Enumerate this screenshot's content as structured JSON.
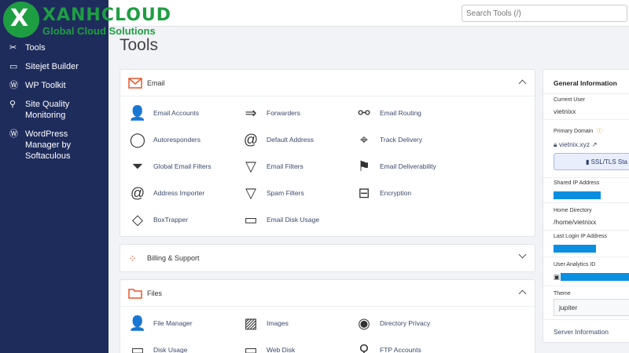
{
  "brand": {
    "logo_x": "X",
    "name": "XANHCLOUD",
    "tagline": "Global Cloud Solutions",
    "colors": {
      "sidebar": "#1e2c5c",
      "accent": "#1e9e42",
      "redaction": "#0a8fe0"
    }
  },
  "sidebar": {
    "items": [
      {
        "label": "Tools",
        "icon": "tools-icon"
      },
      {
        "label": "Sitejet Builder",
        "icon": "sitejet-icon"
      },
      {
        "label": "WP Toolkit",
        "icon": "wordpress-icon"
      },
      {
        "label": "Site Quality Monitoring",
        "icon": "magnifier-icon"
      },
      {
        "label": "WordPress Manager by Softaculous",
        "icon": "wordpress-icon"
      }
    ]
  },
  "search": {
    "placeholder": "Search Tools (/)"
  },
  "page": {
    "title": "Tools"
  },
  "email_panel": {
    "title": "Email",
    "tools": [
      {
        "label": "Email Accounts",
        "icon": "user-mail-icon"
      },
      {
        "label": "Forwarders",
        "icon": "forward-icon"
      },
      {
        "label": "Email Routing",
        "icon": "routing-icon"
      },
      {
        "label": "Autoresponders",
        "icon": "autoresponder-icon"
      },
      {
        "label": "Default Address",
        "icon": "at-sign-icon"
      },
      {
        "label": "Track Delivery",
        "icon": "location-pin-icon"
      },
      {
        "label": "Global Email Filters",
        "icon": "global-filter-icon"
      },
      {
        "label": "Email Filters",
        "icon": "filter-icon"
      },
      {
        "label": "Email Deliverability",
        "icon": "mailbox-icon"
      },
      {
        "label": "Address Importer",
        "icon": "at-import-icon"
      },
      {
        "label": "Spam Filters",
        "icon": "spam-filter-icon"
      },
      {
        "label": "Encryption",
        "icon": "encryption-icon"
      },
      {
        "label": "BoxTrapper",
        "icon": "boxtrapper-icon"
      },
      {
        "label": "Email Disk Usage",
        "icon": "disk-usage-icon"
      }
    ]
  },
  "billing_panel": {
    "title": "Billing & Support"
  },
  "files_panel": {
    "title": "Files",
    "tools": [
      {
        "label": "File Manager",
        "icon": "file-manager-icon"
      },
      {
        "label": "Images",
        "icon": "image-icon"
      },
      {
        "label": "Directory Privacy",
        "icon": "eye-icon"
      },
      {
        "label": "Disk Usage",
        "icon": "disk-icon"
      },
      {
        "label": "Web Disk",
        "icon": "web-disk-icon"
      },
      {
        "label": "FTP Accounts",
        "icon": "ftp-icon"
      }
    ]
  },
  "general_info": {
    "title": "General Information",
    "current_user_label": "Current User",
    "current_user": "vietnixx",
    "primary_domain_label": "Primary Domain",
    "primary_domain": "vietnix.xyz",
    "ssl_button": "SSL/TLS Sta",
    "shared_ip_label": "Shared IP Address",
    "home_dir_label": "Home Directory",
    "home_dir": "/home/vietnixx",
    "last_login_label": "Last Login IP Address",
    "analytics_label": "User Analytics ID",
    "theme_label": "Theme",
    "theme_value": "jupiter",
    "server_info_link": "Server Information"
  }
}
